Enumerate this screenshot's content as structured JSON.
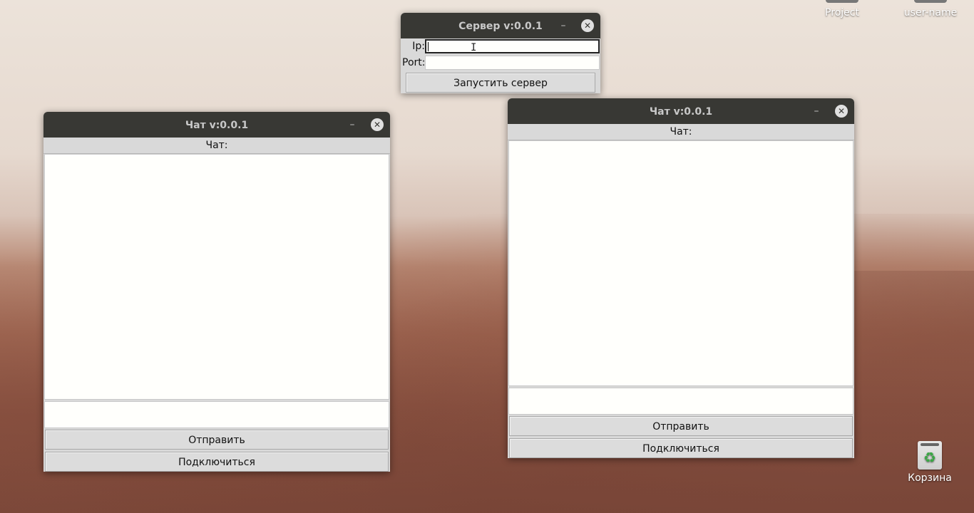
{
  "desktop": {
    "icons": [
      {
        "label": "Project"
      },
      {
        "label": "user-name"
      },
      {
        "label": "Корзина"
      }
    ]
  },
  "server_window": {
    "title": "Сервер v:0.0.1",
    "ip_label": "Ip:",
    "ip_value": "",
    "port_label": "Port:",
    "port_value": "",
    "start_button": "Запустить сервер"
  },
  "chat_left": {
    "title": "Чат v:0.0.1",
    "chat_label": "Чат:",
    "message_value": "",
    "send_button": "Отправить",
    "connect_button": "Подключиться"
  },
  "chat_right": {
    "title": "Чат v:0.0.1",
    "chat_label": "Чат:",
    "message_value": "",
    "send_button": "Отправить",
    "connect_button": "Подключиться"
  },
  "window_controls": {
    "minimize": "–",
    "close": "✕"
  }
}
